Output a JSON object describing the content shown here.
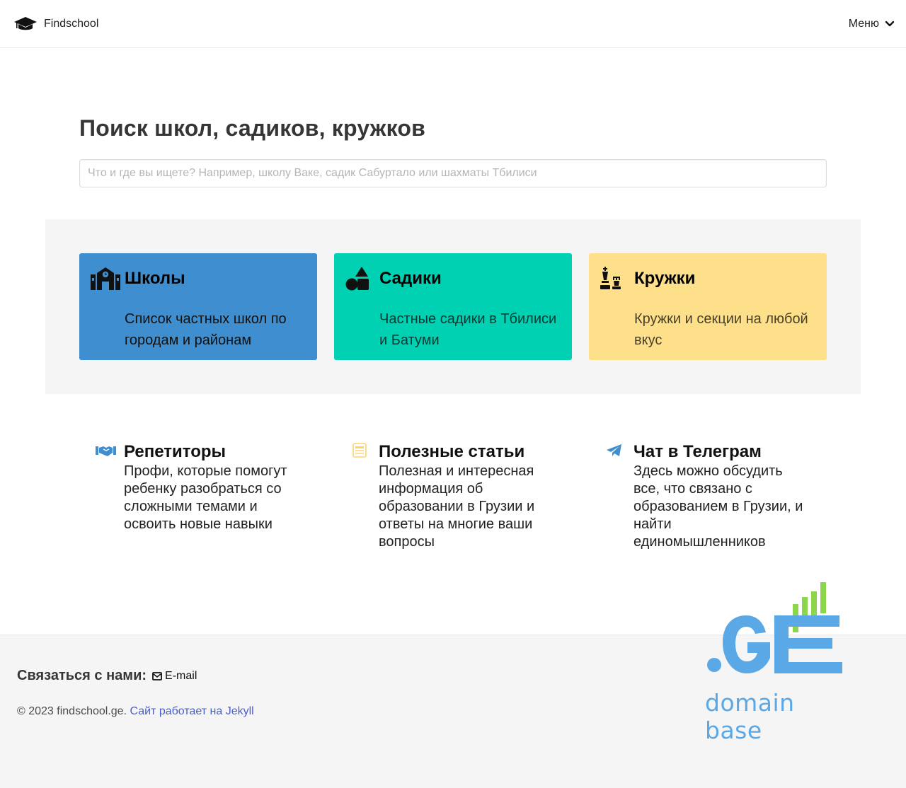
{
  "header": {
    "brand": "Findschool",
    "menu_label": "Меню"
  },
  "hero": {
    "title": "Поиск школ, садиков, кружков",
    "search_placeholder": "Что и где вы ищете? Например, школу Ваке, садик Сабуртало или шахматы Тбилиси"
  },
  "cards": [
    {
      "title": "Школы",
      "description": "Список частных школ по городам и районам",
      "icon": "school-icon",
      "color": "#3e8ed0"
    },
    {
      "title": "Садики",
      "description": "Частные садики в Тбилиси и Батуми",
      "icon": "shapes-icon",
      "color": "#00d1b2"
    },
    {
      "title": "Кружки",
      "description": "Кружки и секции на любой вкус",
      "icon": "chess-icon",
      "color": "#ffe08a"
    }
  ],
  "features": [
    {
      "title": "Репетиторы",
      "description": "Профи, которые помогут ребенку разобраться со сложными темами и освоить новые навыки",
      "icon": "handshake-icon",
      "color": "#3e8ed0"
    },
    {
      "title": "Полезные статьи",
      "description": "Полезная и интересная информация об образовании в Грузии и ответы на многие ваши вопросы",
      "icon": "newspaper-icon",
      "color": "#ffe08a"
    },
    {
      "title": "Чат в Телеграм",
      "description": "Здесь можно обсудить все, что связано с образованием в Грузии, и найти единомышленников",
      "icon": "telegram-icon",
      "color": "#3e8ed0"
    }
  ],
  "footer": {
    "contact_label": "Связаться с нами:",
    "email_label": "E-mail",
    "copyright": "© 2023 findschool.ge.",
    "jekyll_link": "Сайт работает на Jekyll"
  },
  "domain_badge": {
    "caption": "domain base",
    "text": ".GE",
    "color_blue": "#5aa8e6",
    "color_green": "#8bd64a"
  }
}
